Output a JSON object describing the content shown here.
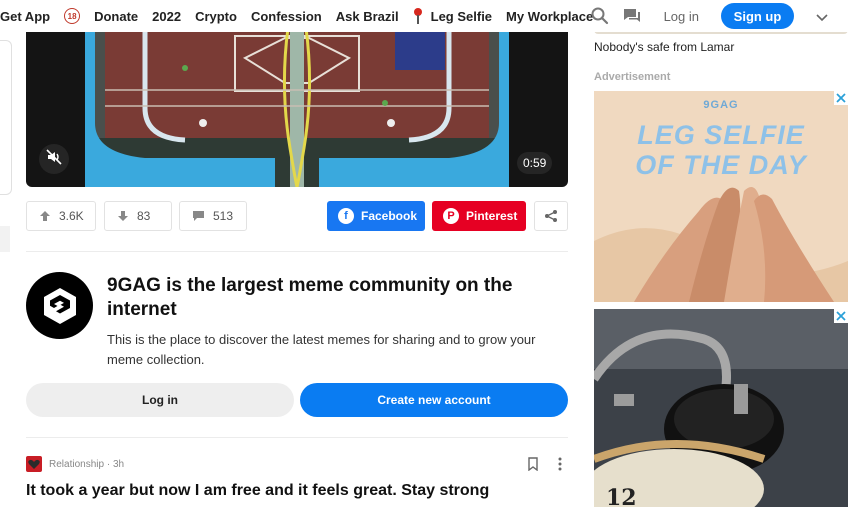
{
  "nav": {
    "items": [
      "Get App",
      "Donate",
      "2022",
      "Crypto",
      "Confession",
      "Ask Brazil",
      "Leg Selfie",
      "My Workplace"
    ],
    "age_badge": "18",
    "login": "Log in",
    "signup": "Sign up"
  },
  "video": {
    "duration": "0:59"
  },
  "post_actions": {
    "upvotes": "3.6K",
    "downvotes": "83",
    "comments": "513",
    "facebook": "Facebook",
    "pinterest": "Pinterest"
  },
  "community": {
    "title": "9GAG is the largest meme community on the internet",
    "description": "This is the place to discover the latest memes for sharing and to grow your meme collection.",
    "login": "Log in",
    "create": "Create new account"
  },
  "next_post": {
    "section": "Relationship",
    "age": "3h",
    "title": "It took a year but now I am free and it feels great. Stay strong"
  },
  "sidebar": {
    "caption": "Nobody's safe from Lamar",
    "ad_label": "Advertisement",
    "ad1_brand": "9GAG",
    "ad1_line1": "LEG SELFIE",
    "ad1_line2": "OF THE DAY"
  },
  "colors": {
    "brand_blue": "#0a7cf2",
    "facebook": "#1877f2",
    "pinterest": "#e60023"
  },
  "icons": [
    "search-icon",
    "notification-icon",
    "chevron-down-icon",
    "mute-icon",
    "upvote-icon",
    "downvote-icon",
    "comment-icon",
    "facebook-icon",
    "pinterest-icon",
    "share-icon",
    "bookmark-icon",
    "more-icon",
    "pin-icon",
    "adchoice-icon"
  ]
}
